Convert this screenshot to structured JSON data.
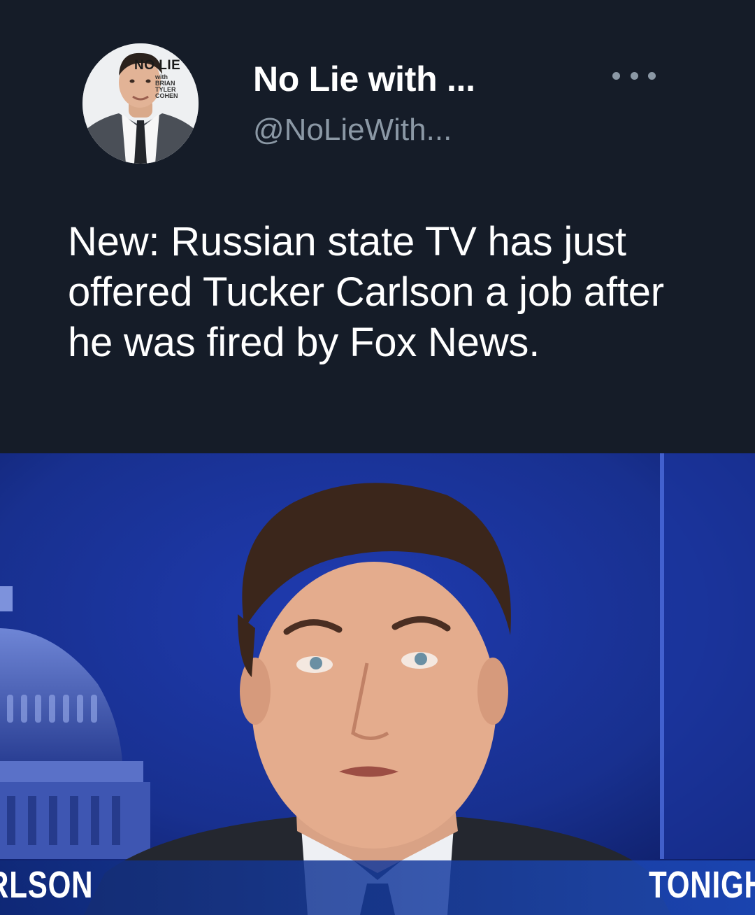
{
  "author": {
    "display_name": "No Lie with ...",
    "handle": "@NoLieWith...",
    "avatar_badge": {
      "title": "NO LIE",
      "lines": [
        "with",
        "BRIAN",
        "TYLER",
        "COHEN"
      ]
    }
  },
  "actions": {
    "more_icon": "more-horizontal-icon"
  },
  "tweet": {
    "text": "New: Russian state TV has just offered Tucker Carlson a job after he was fired by Fox News."
  },
  "media": {
    "lower_third_left": "RLSON",
    "lower_third_right": "TONIGH"
  },
  "colors": {
    "background": "#151c28",
    "name": "#ffffff",
    "handle": "#8b98a5",
    "studio_blue": "#1a2f8a"
  }
}
